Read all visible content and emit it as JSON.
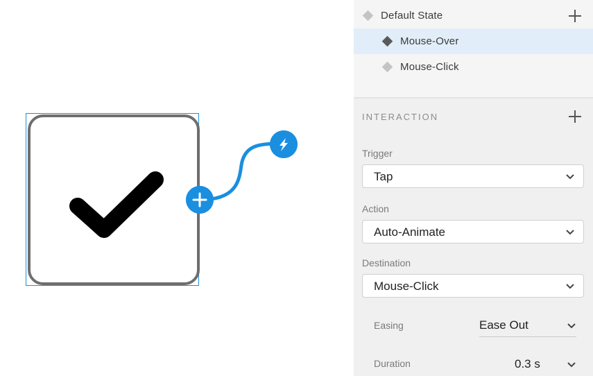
{
  "states": {
    "items": [
      {
        "label": "Default State",
        "icon": "diamond-icon",
        "selected": false
      },
      {
        "label": "Mouse-Over",
        "icon": "diamond-icon",
        "selected": true
      },
      {
        "label": "Mouse-Click",
        "icon": "diamond-icon",
        "selected": false
      }
    ],
    "add_icon": "plus-icon"
  },
  "interaction": {
    "title": "INTERACTION",
    "add_icon": "plus-icon",
    "trigger": {
      "label": "Trigger",
      "value": "Tap"
    },
    "action": {
      "label": "Action",
      "value": "Auto-Animate"
    },
    "destination": {
      "label": "Destination",
      "value": "Mouse-Click"
    },
    "easing": {
      "label": "Easing",
      "value": "Ease Out"
    },
    "duration": {
      "label": "Duration",
      "value": "0.3 s"
    }
  },
  "canvas": {
    "checkbox_icon": "checkmark-icon",
    "add_handle_icon": "plus-icon",
    "trigger_handle_icon": "lightning-bolt-icon",
    "accent_color": "#1a8fe0"
  }
}
